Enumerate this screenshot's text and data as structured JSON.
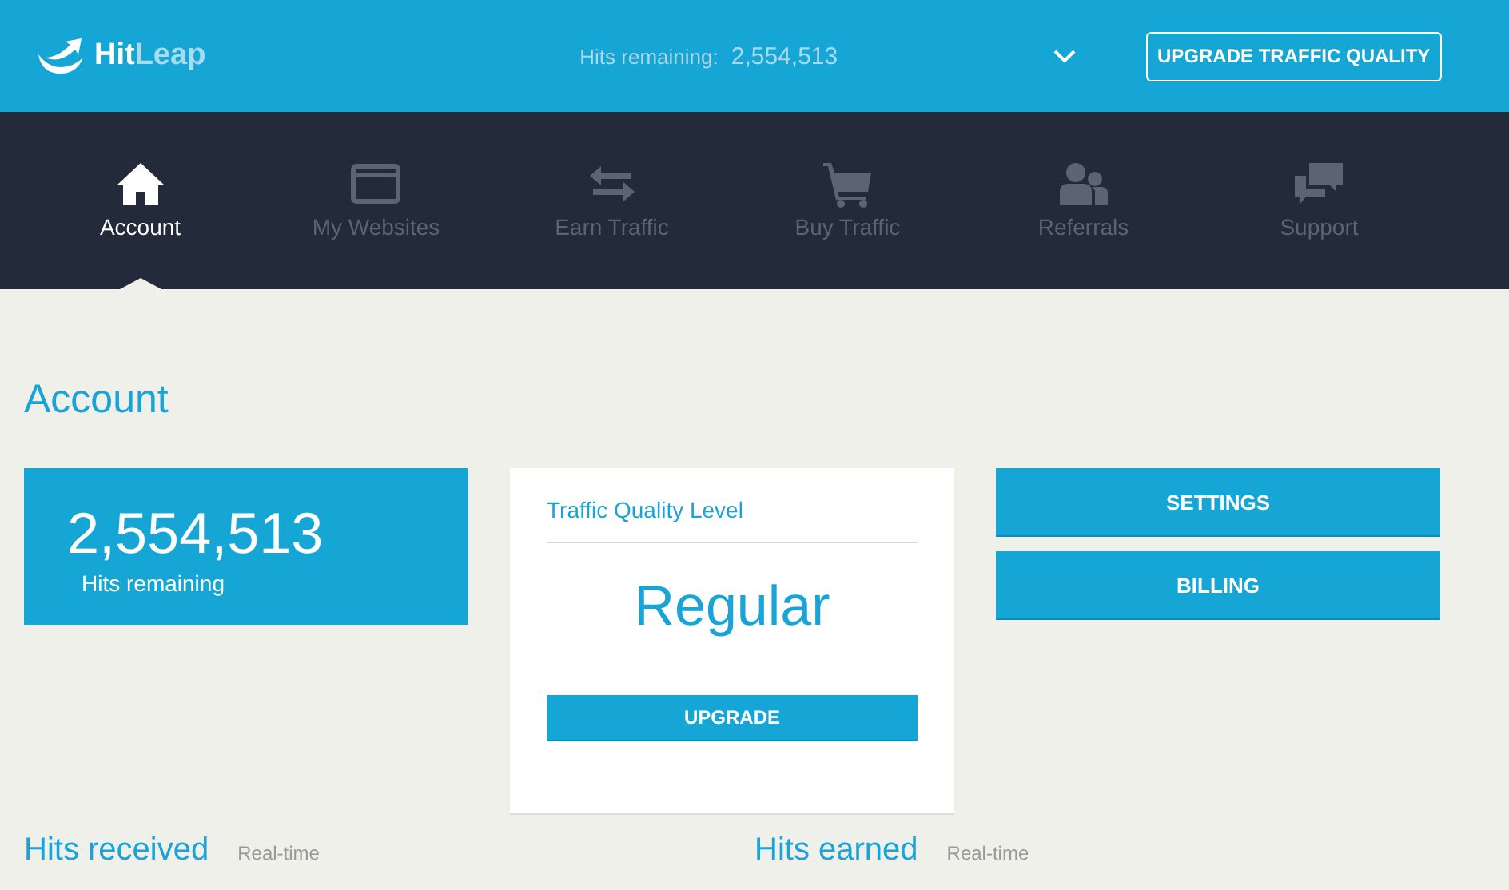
{
  "header": {
    "logo": {
      "part_1": "Hit",
      "part_2": "Leap"
    },
    "hits_label": "Hits remaining:",
    "hits_value": "2,554,513",
    "upgrade_button": "UPGRADE TRAFFIC QUALITY"
  },
  "nav": [
    {
      "label": "Account",
      "kind": "home",
      "selected": true
    },
    {
      "label": "My Websites",
      "kind": "window",
      "selected": false
    },
    {
      "label": "Earn Traffic",
      "kind": "arrows",
      "selected": false
    },
    {
      "label": "Buy Traffic",
      "kind": "cart",
      "selected": false
    },
    {
      "label": "Referrals",
      "kind": "people",
      "selected": false
    },
    {
      "label": "Support",
      "kind": "chat",
      "selected": false
    }
  ],
  "page_title": "Account",
  "hits_card": {
    "value": "2,554,513",
    "label": "Hits remaining"
  },
  "quality_card": {
    "title": "Traffic Quality Level",
    "level": "Regular",
    "button": "UPGRADE"
  },
  "actions": [
    "SETTINGS",
    "BILLING"
  ],
  "sections": [
    {
      "title": "Hits received",
      "note": "Real-time"
    },
    {
      "title": "Hits earned",
      "note": "Real-time"
    }
  ]
}
